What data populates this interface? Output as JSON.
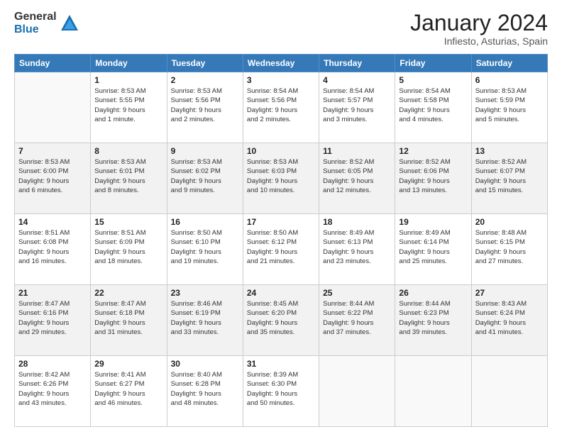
{
  "logo": {
    "general": "General",
    "blue": "Blue"
  },
  "header": {
    "month": "January 2024",
    "location": "Infiesto, Asturias, Spain"
  },
  "weekdays": [
    "Sunday",
    "Monday",
    "Tuesday",
    "Wednesday",
    "Thursday",
    "Friday",
    "Saturday"
  ],
  "weeks": [
    [
      {
        "day": "",
        "info": ""
      },
      {
        "day": "1",
        "info": "Sunrise: 8:53 AM\nSunset: 5:55 PM\nDaylight: 9 hours\nand 1 minute."
      },
      {
        "day": "2",
        "info": "Sunrise: 8:53 AM\nSunset: 5:56 PM\nDaylight: 9 hours\nand 2 minutes."
      },
      {
        "day": "3",
        "info": "Sunrise: 8:54 AM\nSunset: 5:56 PM\nDaylight: 9 hours\nand 2 minutes."
      },
      {
        "day": "4",
        "info": "Sunrise: 8:54 AM\nSunset: 5:57 PM\nDaylight: 9 hours\nand 3 minutes."
      },
      {
        "day": "5",
        "info": "Sunrise: 8:54 AM\nSunset: 5:58 PM\nDaylight: 9 hours\nand 4 minutes."
      },
      {
        "day": "6",
        "info": "Sunrise: 8:53 AM\nSunset: 5:59 PM\nDaylight: 9 hours\nand 5 minutes."
      }
    ],
    [
      {
        "day": "7",
        "info": "Sunrise: 8:53 AM\nSunset: 6:00 PM\nDaylight: 9 hours\nand 6 minutes."
      },
      {
        "day": "8",
        "info": "Sunrise: 8:53 AM\nSunset: 6:01 PM\nDaylight: 9 hours\nand 8 minutes."
      },
      {
        "day": "9",
        "info": "Sunrise: 8:53 AM\nSunset: 6:02 PM\nDaylight: 9 hours\nand 9 minutes."
      },
      {
        "day": "10",
        "info": "Sunrise: 8:53 AM\nSunset: 6:03 PM\nDaylight: 9 hours\nand 10 minutes."
      },
      {
        "day": "11",
        "info": "Sunrise: 8:52 AM\nSunset: 6:05 PM\nDaylight: 9 hours\nand 12 minutes."
      },
      {
        "day": "12",
        "info": "Sunrise: 8:52 AM\nSunset: 6:06 PM\nDaylight: 9 hours\nand 13 minutes."
      },
      {
        "day": "13",
        "info": "Sunrise: 8:52 AM\nSunset: 6:07 PM\nDaylight: 9 hours\nand 15 minutes."
      }
    ],
    [
      {
        "day": "14",
        "info": "Sunrise: 8:51 AM\nSunset: 6:08 PM\nDaylight: 9 hours\nand 16 minutes."
      },
      {
        "day": "15",
        "info": "Sunrise: 8:51 AM\nSunset: 6:09 PM\nDaylight: 9 hours\nand 18 minutes."
      },
      {
        "day": "16",
        "info": "Sunrise: 8:50 AM\nSunset: 6:10 PM\nDaylight: 9 hours\nand 19 minutes."
      },
      {
        "day": "17",
        "info": "Sunrise: 8:50 AM\nSunset: 6:12 PM\nDaylight: 9 hours\nand 21 minutes."
      },
      {
        "day": "18",
        "info": "Sunrise: 8:49 AM\nSunset: 6:13 PM\nDaylight: 9 hours\nand 23 minutes."
      },
      {
        "day": "19",
        "info": "Sunrise: 8:49 AM\nSunset: 6:14 PM\nDaylight: 9 hours\nand 25 minutes."
      },
      {
        "day": "20",
        "info": "Sunrise: 8:48 AM\nSunset: 6:15 PM\nDaylight: 9 hours\nand 27 minutes."
      }
    ],
    [
      {
        "day": "21",
        "info": "Sunrise: 8:47 AM\nSunset: 6:16 PM\nDaylight: 9 hours\nand 29 minutes."
      },
      {
        "day": "22",
        "info": "Sunrise: 8:47 AM\nSunset: 6:18 PM\nDaylight: 9 hours\nand 31 minutes."
      },
      {
        "day": "23",
        "info": "Sunrise: 8:46 AM\nSunset: 6:19 PM\nDaylight: 9 hours\nand 33 minutes."
      },
      {
        "day": "24",
        "info": "Sunrise: 8:45 AM\nSunset: 6:20 PM\nDaylight: 9 hours\nand 35 minutes."
      },
      {
        "day": "25",
        "info": "Sunrise: 8:44 AM\nSunset: 6:22 PM\nDaylight: 9 hours\nand 37 minutes."
      },
      {
        "day": "26",
        "info": "Sunrise: 8:44 AM\nSunset: 6:23 PM\nDaylight: 9 hours\nand 39 minutes."
      },
      {
        "day": "27",
        "info": "Sunrise: 8:43 AM\nSunset: 6:24 PM\nDaylight: 9 hours\nand 41 minutes."
      }
    ],
    [
      {
        "day": "28",
        "info": "Sunrise: 8:42 AM\nSunset: 6:26 PM\nDaylight: 9 hours\nand 43 minutes."
      },
      {
        "day": "29",
        "info": "Sunrise: 8:41 AM\nSunset: 6:27 PM\nDaylight: 9 hours\nand 46 minutes."
      },
      {
        "day": "30",
        "info": "Sunrise: 8:40 AM\nSunset: 6:28 PM\nDaylight: 9 hours\nand 48 minutes."
      },
      {
        "day": "31",
        "info": "Sunrise: 8:39 AM\nSunset: 6:30 PM\nDaylight: 9 hours\nand 50 minutes."
      },
      {
        "day": "",
        "info": ""
      },
      {
        "day": "",
        "info": ""
      },
      {
        "day": "",
        "info": ""
      }
    ]
  ]
}
